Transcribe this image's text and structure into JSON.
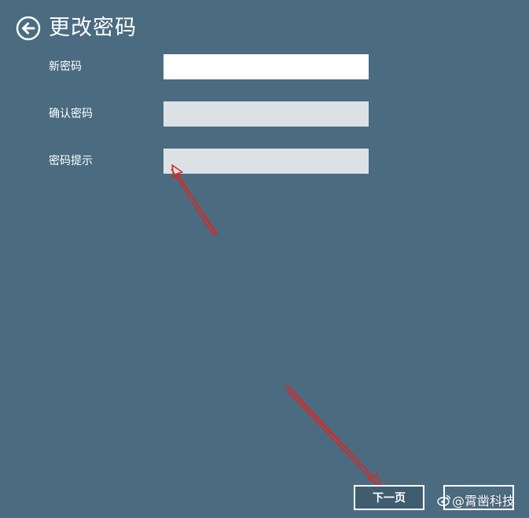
{
  "header": {
    "back_icon": "back-arrow-circle-icon",
    "title": "更改密码"
  },
  "form": {
    "fields": [
      {
        "label": "新密码",
        "value": ""
      },
      {
        "label": "确认密码",
        "value": ""
      },
      {
        "label": "密码提示",
        "value": ""
      }
    ]
  },
  "footer": {
    "next_label": "下一页"
  },
  "watermark": {
    "icon": "weibo-logo-icon",
    "text": "@霄凿科技"
  },
  "colors": {
    "background": "#4b6c80",
    "text": "#ffffff",
    "input_active": "#ffffff",
    "input_inactive": "#dbe1e5",
    "annotation": "#d42a2a"
  }
}
